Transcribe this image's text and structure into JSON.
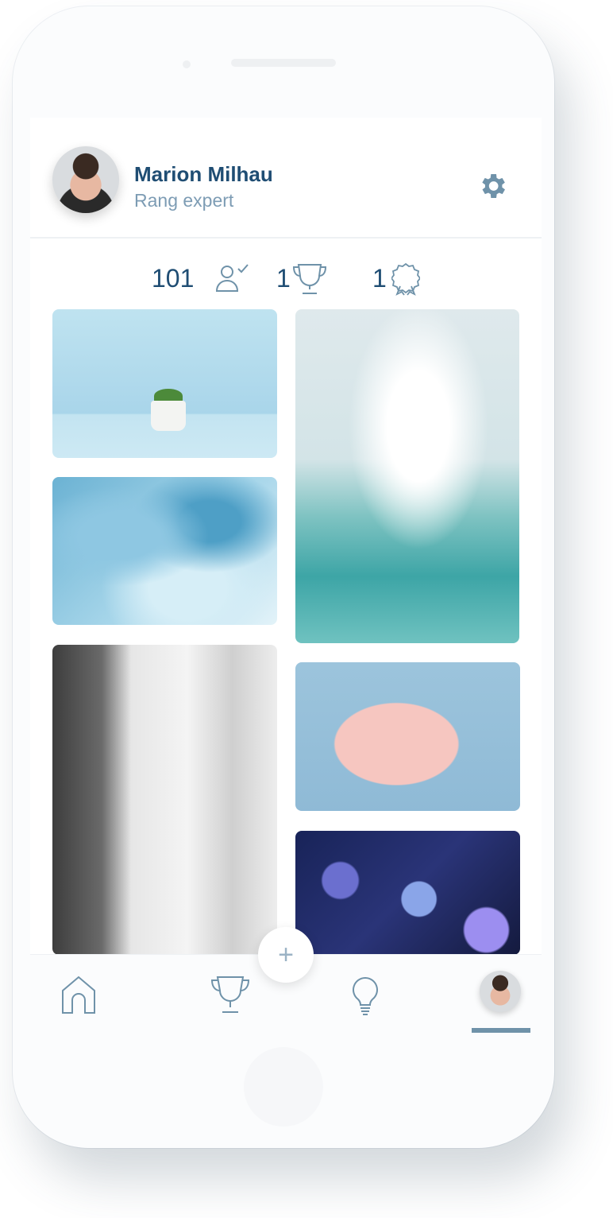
{
  "profile": {
    "name": "Marion Milhau",
    "rank": "Rang expert"
  },
  "stats": [
    {
      "value": "101",
      "icon": "user-check-icon"
    },
    {
      "value": "1",
      "icon": "trophy-icon"
    },
    {
      "value": "1",
      "icon": "award-badge-icon"
    }
  ],
  "gallery": [
    {
      "subject": "plant-in-pot"
    },
    {
      "subject": "water-texture"
    },
    {
      "subject": "white-house-stairs"
    },
    {
      "subject": "clouds-over-sea"
    },
    {
      "subject": "suitcase-with-shoes"
    },
    {
      "subject": "blue-roses"
    }
  ],
  "nav": {
    "items": [
      "home-icon",
      "trophy-icon",
      "lightbulb-icon",
      "profile-avatar"
    ],
    "active": "profile-avatar",
    "fab_icon": "plus-icon",
    "fab_symbol": "+"
  },
  "colors": {
    "primary": "#1f4d73",
    "secondary": "#7d9cb4",
    "accent": "#6f92a9",
    "icon": "#6f92a9"
  }
}
